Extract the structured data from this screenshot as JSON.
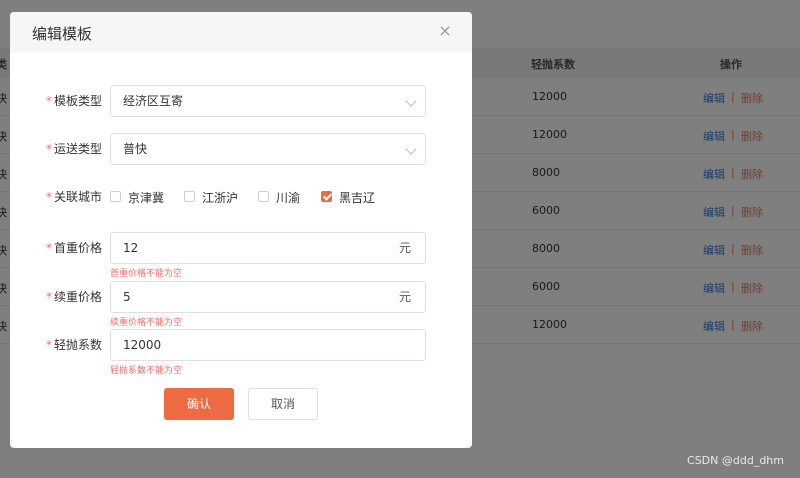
{
  "background": {
    "columns": [
      {
        "key": "left",
        "label": "类"
      },
      {
        "key": "ratio",
        "label": "轻抛系数"
      },
      {
        "key": "actions",
        "label": "操作"
      }
    ],
    "rows": [
      {
        "left": "快",
        "ratio": "12000",
        "edit": "编辑",
        "sep": "|",
        "del": "删除"
      },
      {
        "left": "快",
        "ratio": "12000",
        "edit": "编辑",
        "sep": "|",
        "del": "删除"
      },
      {
        "left": "快",
        "ratio": "8000",
        "edit": "编辑",
        "sep": "|",
        "del": "删除"
      },
      {
        "left": "快",
        "ratio": "6000",
        "edit": "编辑",
        "sep": "|",
        "del": "删除"
      },
      {
        "left": "快",
        "ratio": "8000",
        "edit": "编辑",
        "sep": "|",
        "del": "删除"
      },
      {
        "left": "快",
        "ratio": "6000",
        "edit": "编辑",
        "sep": "|",
        "del": "删除"
      },
      {
        "left": "快",
        "ratio": "12000",
        "edit": "编辑",
        "sep": "|",
        "del": "删除"
      }
    ]
  },
  "dialog": {
    "title": "编辑模板",
    "close_icon": "close-icon",
    "required_mark": "*",
    "template_type": {
      "label": "模板类型",
      "value": "经济区互寄"
    },
    "transport_type": {
      "label": "运送类型",
      "value": "普快"
    },
    "cities": {
      "label": "关联城市",
      "options": [
        {
          "label": "京津冀",
          "checked": false
        },
        {
          "label": "江浙沪",
          "checked": false
        },
        {
          "label": "川渝",
          "checked": false
        },
        {
          "label": "黑吉辽",
          "checked": true
        }
      ]
    },
    "first_price": {
      "label": "首重价格",
      "value": "12",
      "suffix": "元",
      "error": "首重价格不能为空"
    },
    "cont_price": {
      "label": "续重价格",
      "value": "5",
      "suffix": "元",
      "error": "续重价格不能为空"
    },
    "light_ratio": {
      "label": "轻抛系数",
      "value": "12000",
      "error": "轻抛系数不能为空"
    },
    "confirm_label": "确认",
    "cancel_label": "取消"
  },
  "watermark": "CSDN @ddd_dhm",
  "colors": {
    "accent": "#ee6a43",
    "error": "#f56c6c",
    "link": "#3478d6"
  }
}
